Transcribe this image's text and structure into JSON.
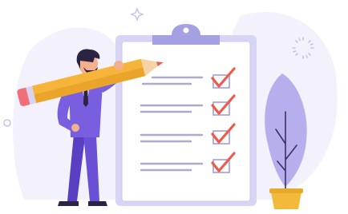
{
  "illustration": {
    "colors": {
      "background_blob": "#f1f0fb",
      "board_outline": "#c9c6ef",
      "board_fill": "#ffffff",
      "clip": "#a59fe4",
      "text_lines": "#b0aaca",
      "checkmark": "#ef5a4a",
      "checkbox": "#9b95de",
      "suit": "#7a5ee0",
      "suit_dark": "#5a3fc2",
      "skin": "#f5b08e",
      "hair": "#2c2342",
      "pencil_body": "#f6b53a",
      "pencil_tip": "#f7d2a6",
      "pencil_eraser": "#ef6e7a",
      "plant_leaf": "#a89ee8",
      "pot": "#f2b93a",
      "sparkle": "#c5c0ec"
    },
    "checklist_item_count": 4,
    "checked_item_count": 4,
    "icons": [
      "clipboard-icon",
      "checkmark-icon",
      "pencil-icon",
      "plant-icon",
      "sparkle-icon",
      "sunburst-icon"
    ]
  }
}
